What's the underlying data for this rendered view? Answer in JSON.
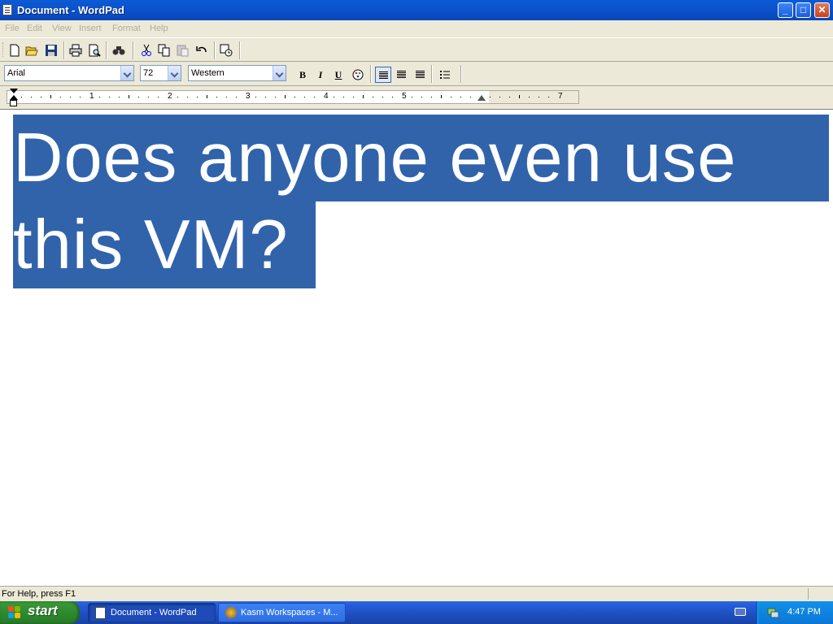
{
  "window": {
    "title": "Document - WordPad",
    "controls": {
      "minimize": "_",
      "maximize": "□",
      "close": "✕"
    }
  },
  "menu": [
    "File",
    "Edit",
    "View",
    "Insert",
    "Format",
    "Help"
  ],
  "toolbar": {
    "icons": [
      "new-icon",
      "open-icon",
      "save-icon",
      "print-icon",
      "print-preview-icon",
      "find-icon",
      "cut-icon",
      "copy-icon",
      "paste-icon",
      "undo-icon",
      "insert-datetime-icon"
    ]
  },
  "format_bar": {
    "font": "Arial",
    "size": "72",
    "script": "Western",
    "bold": "B",
    "italic": "I",
    "underline": "U"
  },
  "ruler": {
    "numbers": [
      "1",
      "2",
      "3",
      "4",
      "5",
      "7"
    ]
  },
  "document": {
    "lines": [
      "Does anyone even use",
      "this VM?"
    ],
    "selection_color": "#3163ab"
  },
  "status": {
    "text": "For Help, press F1"
  },
  "taskbar": {
    "start": "start",
    "tasks": [
      {
        "label": "Document - WordPad"
      },
      {
        "label": "Kasm Workspaces - M..."
      }
    ],
    "clock": "4:47 PM"
  }
}
